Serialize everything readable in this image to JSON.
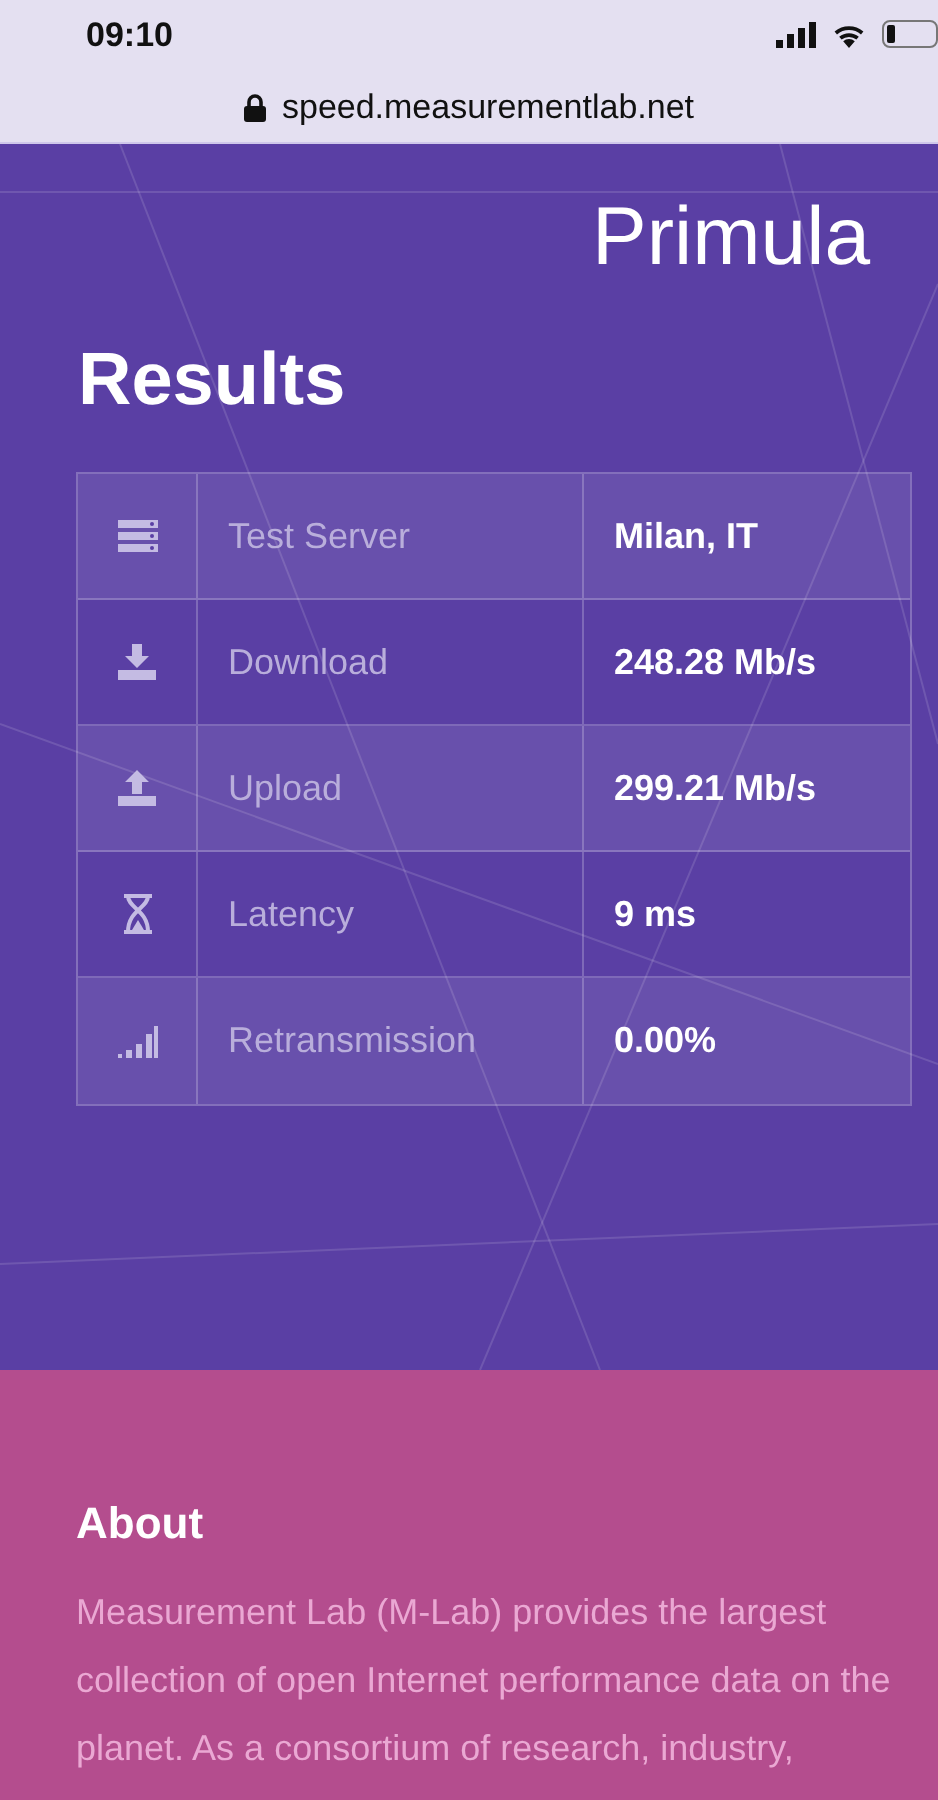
{
  "status_bar": {
    "time": "09:10"
  },
  "address_bar": {
    "url": "speed.measurementlab.net"
  },
  "header": {
    "site_name": "Primula"
  },
  "results": {
    "title": "Results",
    "rows": [
      {
        "label": "Test Server",
        "value": "Milan, IT"
      },
      {
        "label": "Download",
        "value": "248.28 Mb/s"
      },
      {
        "label": "Upload",
        "value": "299.21 Mb/s"
      },
      {
        "label": "Latency",
        "value": "9 ms"
      },
      {
        "label": "Retransmission",
        "value": "0.00%"
      }
    ]
  },
  "about": {
    "title": "About",
    "text": "Measurement Lab (M-Lab) provides the largest collection of open Internet performance data on the planet. As a consortium of research, industry,"
  }
}
